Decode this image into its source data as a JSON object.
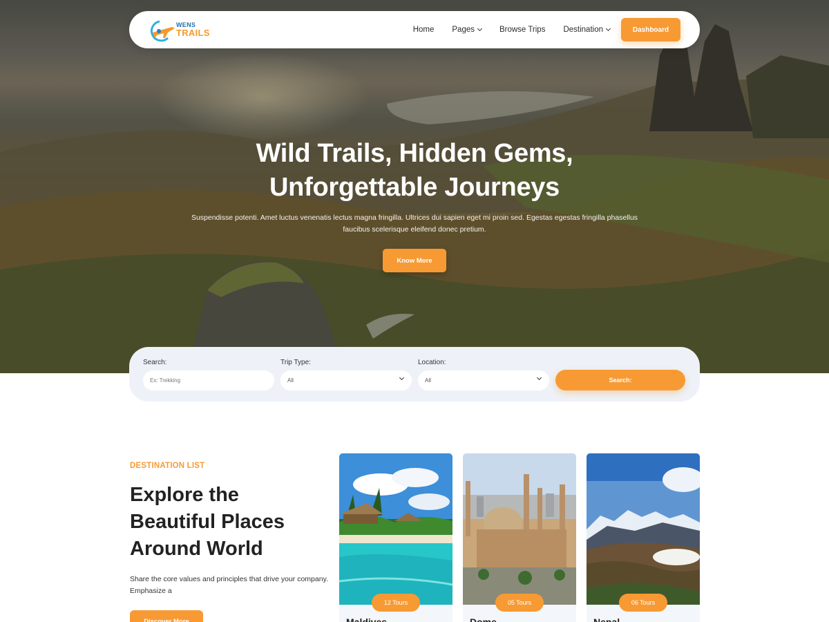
{
  "brand": {
    "line1": "WENS",
    "line2": "TRAILS"
  },
  "nav": {
    "items": [
      {
        "label": "Home",
        "dropdown": false
      },
      {
        "label": "Pages",
        "dropdown": true
      },
      {
        "label": "Browse Trips",
        "dropdown": false
      },
      {
        "label": "Destination",
        "dropdown": true
      }
    ],
    "cta_label": "Dashboard"
  },
  "hero": {
    "title_line1": "Wild Trails, Hidden Gems,",
    "title_line2": "Unforgettable Journeys",
    "subtitle": "Suspendisse potenti. Amet luctus venenatis lectus magna fringilla. Ultrices dui sapien eget mi proin sed. Egestas egestas fringilla phasellus faucibus scelerisque eleifend donec pretium.",
    "cta_label": "Know More"
  },
  "search": {
    "search_label": "Search:",
    "search_placeholder": "Ex: Trekking",
    "trip_type_label": "Trip Type:",
    "trip_type_value": "All",
    "location_label": "Location:",
    "location_value": "All",
    "button_label": "Search:"
  },
  "destinations": {
    "eyebrow": "DESTINATION LIST",
    "title_line1": "Explore the",
    "title_line2": "Beautiful Places",
    "title_line3": "Around World",
    "description": "Share the core values and principles that drive your company. Emphasize a",
    "cta_label": "Discover More",
    "cards": [
      {
        "name": "Maldives",
        "tours": "12 Tours"
      },
      {
        "name": "Dome",
        "tours": "05 Tours"
      },
      {
        "name": "Nepal",
        "tours": "06 Tours"
      }
    ]
  },
  "colors": {
    "accent": "#f79a33",
    "brand_blue": "#1f6fb8",
    "panel": "#eef2f8"
  }
}
